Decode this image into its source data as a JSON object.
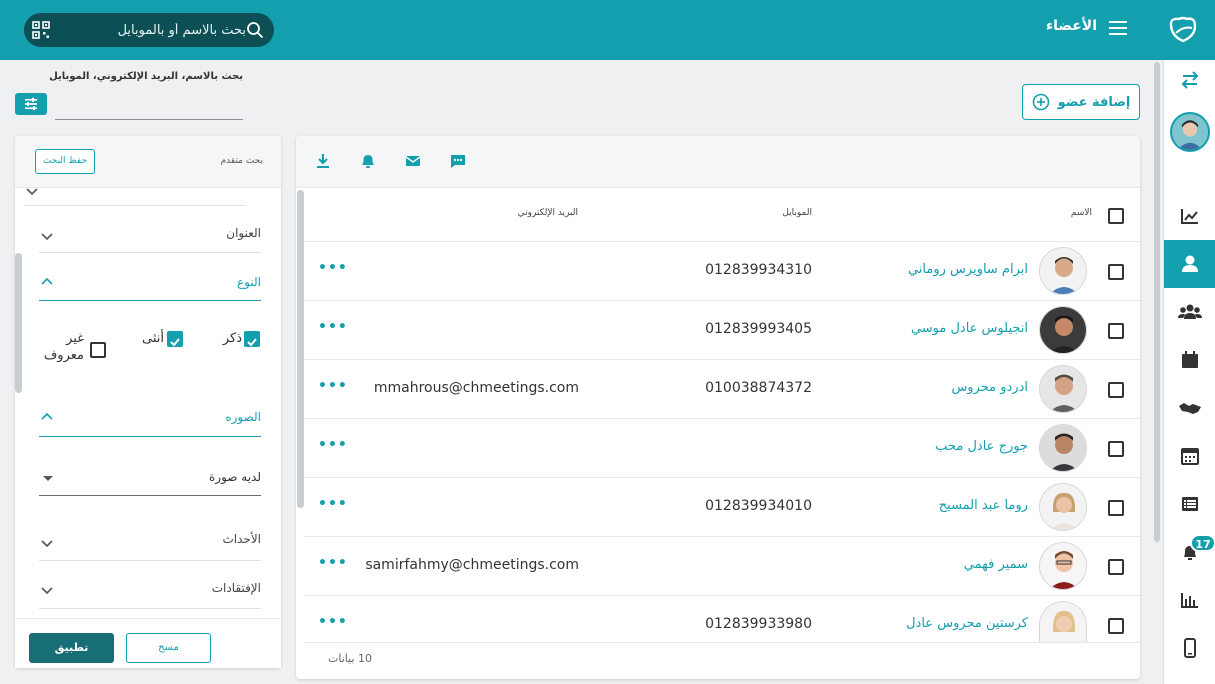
{
  "topbar": {
    "title": "الأعضاء",
    "search_placeholder": "بحث بالاسم أو بالموبايل"
  },
  "search_area": {
    "label": "بحث بالاسم، البريد الإلكتروني، الموبايل",
    "add_member_label": "إضافة عضو"
  },
  "filter_panel": {
    "header_label": "بحث متقدم",
    "save_search_label": "حفظ البحث",
    "sections": {
      "address": "العنوان",
      "gender": "النوع",
      "photo": "الصوره",
      "events": "الأحداث",
      "absences": "الإفتقادات"
    },
    "gender_options": {
      "male": "ذكر",
      "female": "أنثى",
      "unknown": "غير معروف"
    },
    "photo_select_value": "لديه صورة",
    "apply_label": "تطبيق",
    "clear_label": "مسح"
  },
  "table": {
    "headers": {
      "name": "الاسم",
      "mobile": "الموبايل",
      "email": "البريد الإلكتروني"
    },
    "rows": [
      {
        "name": "ابرام ساويرس روماني",
        "mobile": "012839934310",
        "email": ""
      },
      {
        "name": "انجيلوس عادل موسي",
        "mobile": "012839993405",
        "email": ""
      },
      {
        "name": "ادردو محروس",
        "mobile": "010038874372",
        "email": "mmahrous@chmeetings.com"
      },
      {
        "name": "جورج عادل محب",
        "mobile": "",
        "email": ""
      },
      {
        "name": "روما عبد المسيح",
        "mobile": "012839934010",
        "email": ""
      },
      {
        "name": "سمير فهمي",
        "mobile": "",
        "email": "samirfahmy@chmeetings.com"
      },
      {
        "name": "كرستين محروس عادل",
        "mobile": "012839933980",
        "email": ""
      }
    ],
    "more_label": "•••",
    "count_label": "10 بيانات"
  },
  "sidebar": {
    "notification_count": "17"
  },
  "colors": {
    "primary": "#139fad",
    "dark_teal": "#176e77",
    "search_bg": "#0c4f55"
  }
}
